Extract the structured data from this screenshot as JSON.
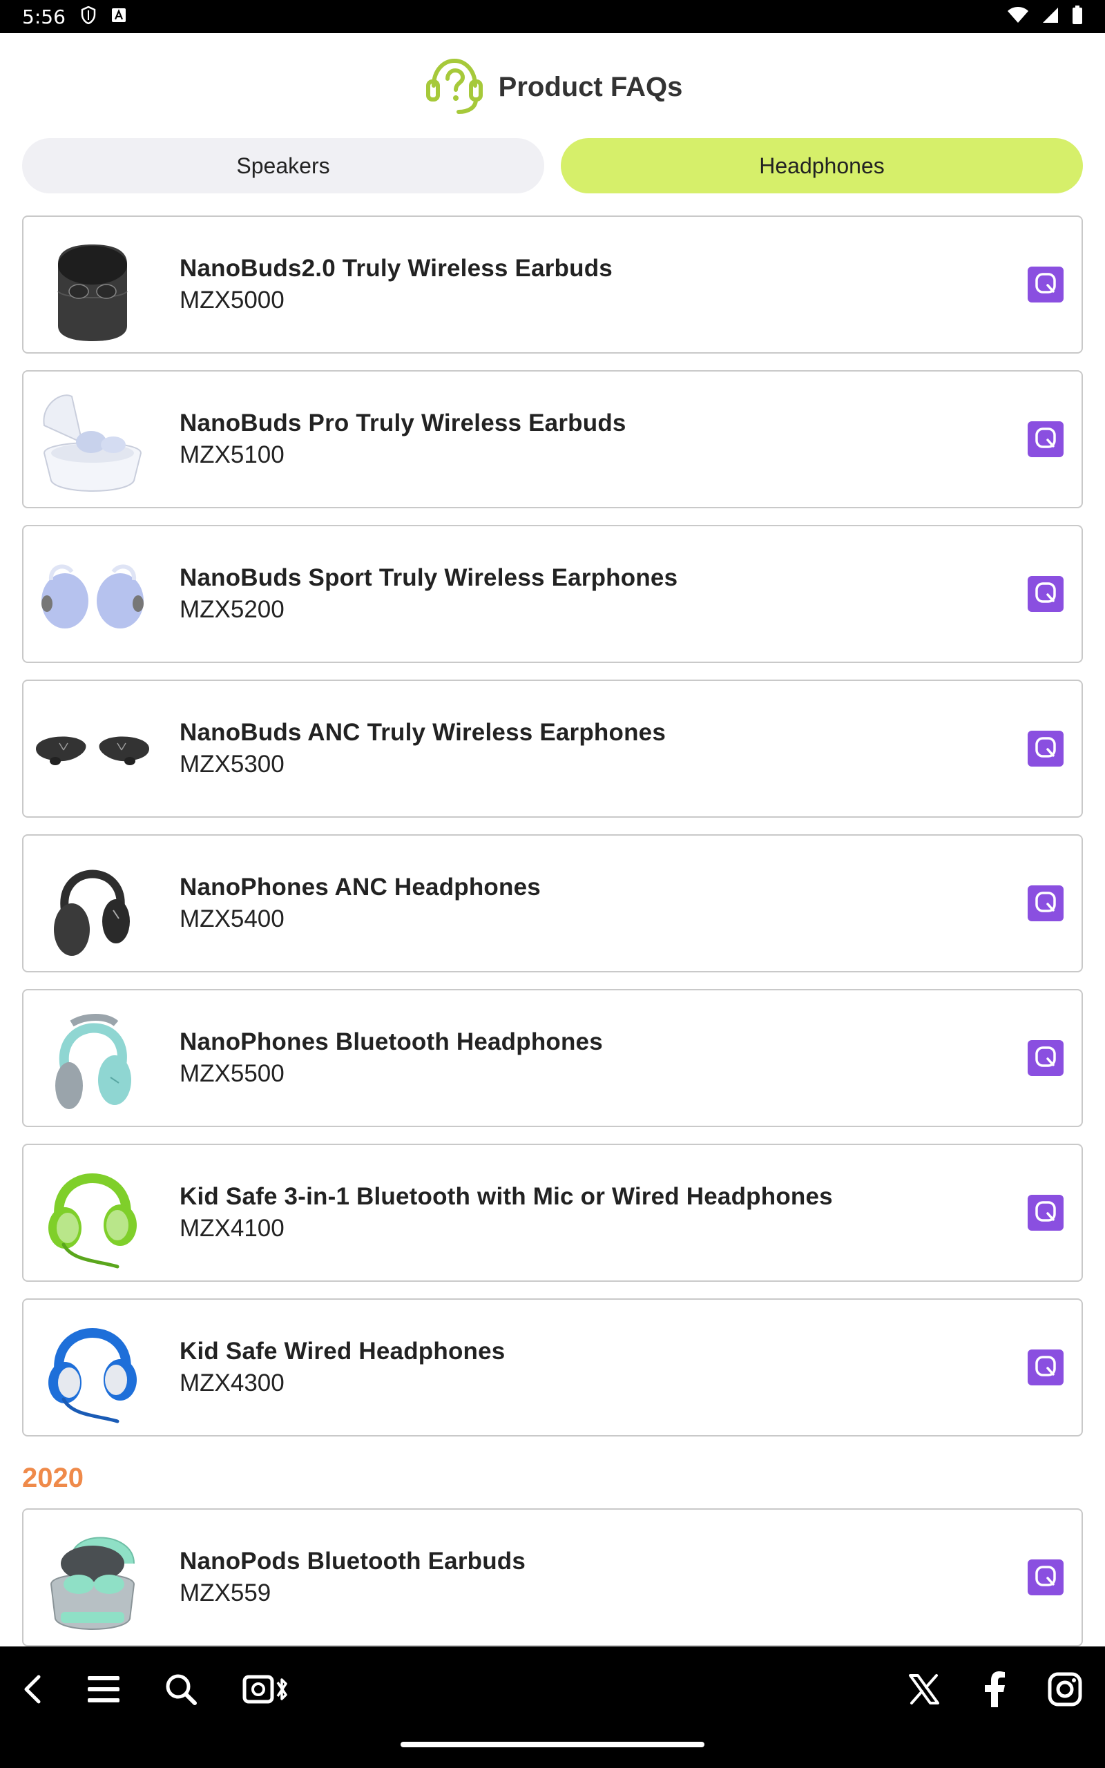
{
  "status_bar": {
    "time": "5:56"
  },
  "header": {
    "title": "Product FAQs"
  },
  "tabs": [
    {
      "label": "Speakers",
      "active": false
    },
    {
      "label": "Headphones",
      "active": true
    }
  ],
  "products": [
    {
      "name": "NanoBuds2.0 Truly Wireless Earbuds",
      "model": "MZX5000",
      "image": "black earbuds charging case"
    },
    {
      "name": "NanoBuds Pro Truly Wireless Earbuds",
      "model": "MZX5100",
      "image": "white earbuds open case"
    },
    {
      "name": "NanoBuds Sport Truly Wireless Earphones",
      "model": "MZX5200",
      "image": "lavender sport earphones"
    },
    {
      "name": "NanoBuds ANC Truly Wireless Earphones",
      "model": "MZX5300",
      "image": "black ANC earphones"
    },
    {
      "name": "NanoPhones ANC Headphones",
      "model": "MZX5400",
      "image": "black over-ear headphones"
    },
    {
      "name": "NanoPhones Bluetooth Headphones",
      "model": "MZX5500",
      "image": "teal over-ear headphones"
    },
    {
      "name": "Kid Safe 3-in-1 Bluetooth with Mic or Wired Headphones",
      "model": "MZX4100",
      "image": "green kids headphones with mic"
    },
    {
      "name": "Kid Safe Wired Headphones",
      "model": "MZX4300",
      "image": "blue kids headphones with mic"
    }
  ],
  "section_2020": {
    "label": "2020",
    "products": [
      {
        "name": "NanoPods Bluetooth Earbuds",
        "model": "MZX559",
        "image": "mint earbuds case"
      }
    ]
  },
  "icons": {
    "faq_button": "q-icon",
    "bottom_nav": [
      "back-icon",
      "menu-icon",
      "search-icon",
      "speaker-bluetooth-icon",
      "x-icon",
      "facebook-icon",
      "instagram-icon"
    ]
  },
  "colors": {
    "active_tab": "#d6ef6a",
    "inactive_tab": "#f0f0f4",
    "faq_button": "#8a4fe0",
    "year_label": "#ef8a4a",
    "header_icon": "#a6c93a"
  }
}
